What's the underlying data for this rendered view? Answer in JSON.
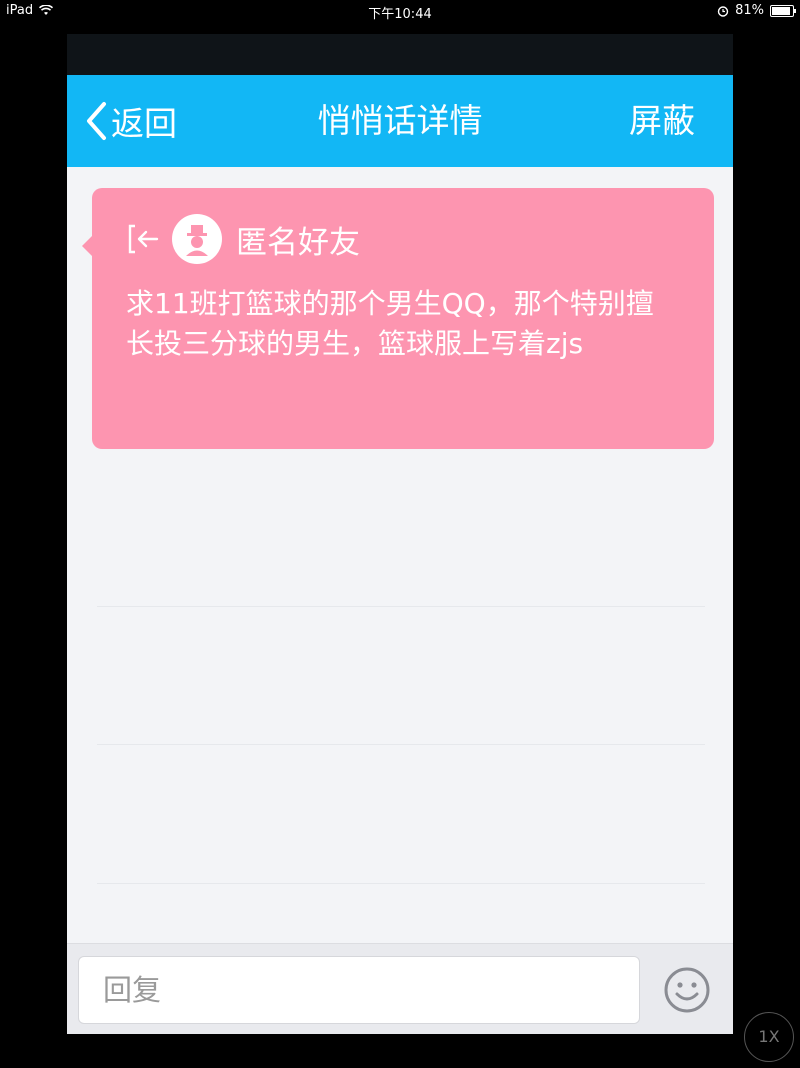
{
  "status_bar": {
    "device": "iPad",
    "time": "下午10:44",
    "battery": "81%",
    "battery_level": 0.81
  },
  "nav": {
    "back_label": "返回",
    "title": "悄悄话详情",
    "block_label": "屏蔽"
  },
  "message": {
    "sender": "匿名好友",
    "text": "求11班打篮球的那个男生QQ，那个特别擅长投三分球的男生，篮球服上写着zjs"
  },
  "reply": {
    "placeholder": "回复"
  },
  "zoom": {
    "label": "1X"
  },
  "colors": {
    "nav_bar": "#12b7f5",
    "bubble": "#fd95b0",
    "background": "#f3f4f7"
  },
  "icons": {
    "back": "chevron-left-icon",
    "enter": "enter-arrow-icon",
    "avatar": "anonymous-avatar-icon",
    "emoji": "smiley-icon",
    "wifi": "wifi-icon",
    "alarm": "alarm-icon"
  }
}
